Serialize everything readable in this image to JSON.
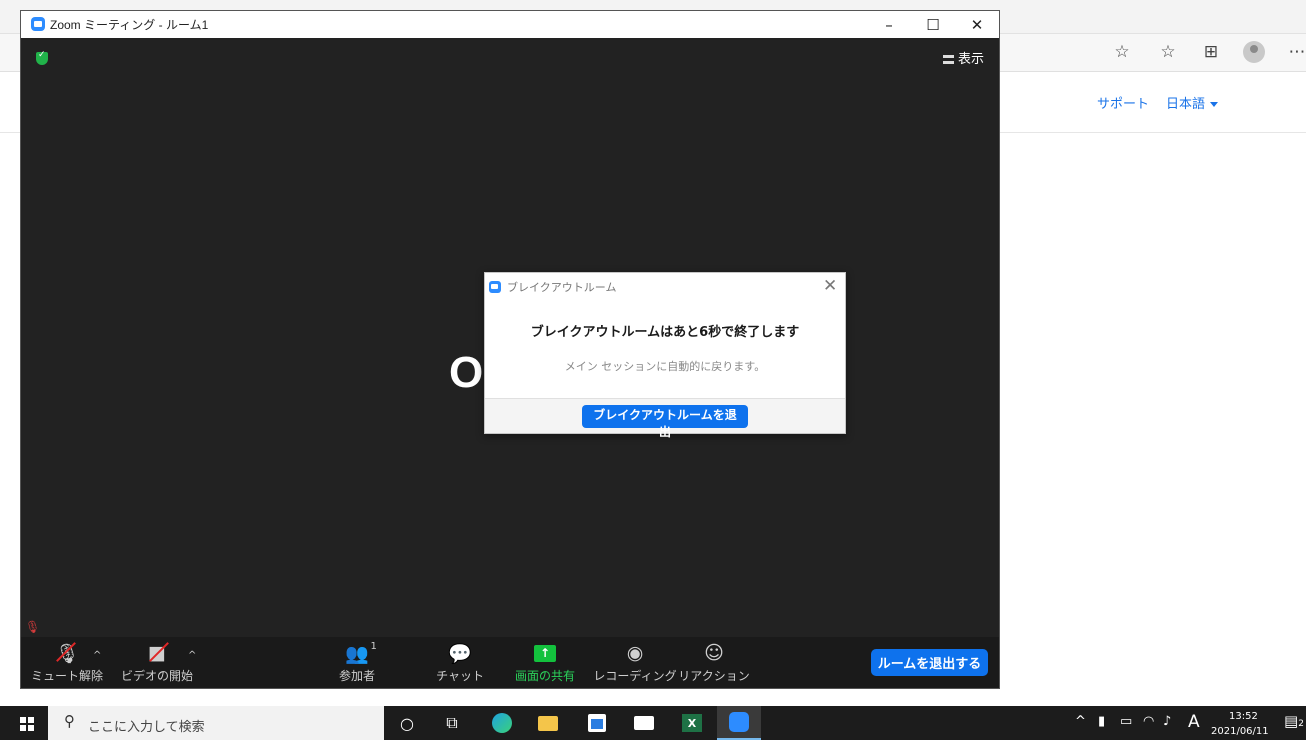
{
  "browser": {
    "support_link": "サポート",
    "language_label": "日本語",
    "icons": [
      "star-icon",
      "favorites-icon",
      "collections-icon",
      "profile-icon",
      "more-icon"
    ]
  },
  "zoom": {
    "window_title": "Zoom ミーティング - ルーム1",
    "view_label": "表示",
    "behind_letter": "O",
    "toolbar": {
      "mute_label": "ミュート解除",
      "video_label": "ビデオの開始",
      "participants_label": "参加者",
      "participants_count": "1",
      "chat_label": "チャット",
      "share_label": "画面の共有",
      "record_label": "レコーディング",
      "reaction_label": "リアクション",
      "leave_room_label": "ルームを退出する"
    }
  },
  "dialog": {
    "title": "ブレイクアウトルーム",
    "heading": "ブレイクアウトルームはあと6秒で終了します",
    "subtext": "メイン セッションに自動的に戻ります。",
    "leave_button": "ブレイクアウトルームを退出"
  },
  "taskbar": {
    "search_placeholder": "ここに入力して検索",
    "tray_ime": "A",
    "clock_time": "13:52",
    "clock_date": "2021/06/11",
    "notification_count": "2"
  },
  "colors": {
    "zoom_blue": "#0e72ed",
    "share_green": "#13c13d",
    "muted_red": "#e02828",
    "meeting_bg": "#222222"
  }
}
